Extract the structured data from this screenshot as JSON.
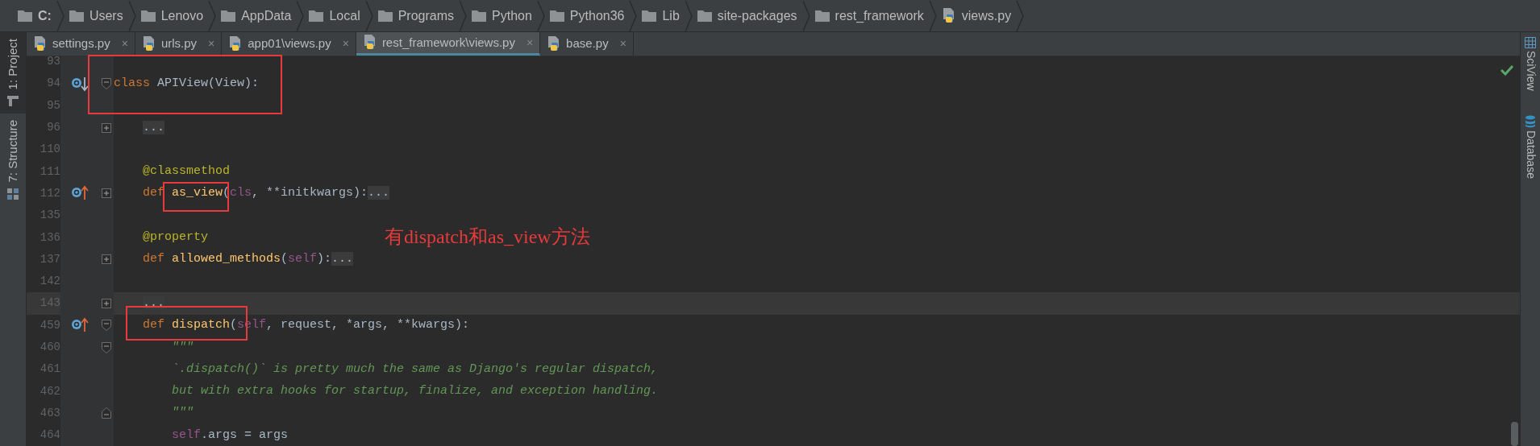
{
  "breadcrumb": [
    {
      "label": "C:",
      "kind": "drive"
    },
    {
      "label": "Users",
      "kind": "folder"
    },
    {
      "label": "Lenovo",
      "kind": "folder"
    },
    {
      "label": "AppData",
      "kind": "folder"
    },
    {
      "label": "Local",
      "kind": "folder"
    },
    {
      "label": "Programs",
      "kind": "folder"
    },
    {
      "label": "Python",
      "kind": "folder"
    },
    {
      "label": "Python36",
      "kind": "folder"
    },
    {
      "label": "Lib",
      "kind": "folder"
    },
    {
      "label": "site-packages",
      "kind": "folder"
    },
    {
      "label": "rest_framework",
      "kind": "folder"
    },
    {
      "label": "views.py",
      "kind": "file"
    }
  ],
  "tabs": [
    {
      "label": "settings.py",
      "close": "×",
      "selected": false
    },
    {
      "label": "urls.py",
      "close": "×",
      "selected": false
    },
    {
      "label": "app01\\views.py",
      "close": "×",
      "selected": false
    },
    {
      "label": "rest_framework\\views.py",
      "close": "×",
      "selected": true
    },
    {
      "label": "base.py",
      "close": "×",
      "selected": false
    }
  ],
  "left_tool_windows": [
    {
      "label": "1: Project",
      "selected": true
    },
    {
      "label": "7: Structure",
      "selected": false
    }
  ],
  "right_tool_windows": [
    {
      "label": "SciView",
      "kind": "sciview"
    },
    {
      "label": "Database",
      "kind": "database"
    }
  ],
  "code_lines": [
    {
      "number": "93",
      "current": false
    },
    {
      "number": "94",
      "current": false,
      "kind": "class",
      "marker": {
        "kind": "overridden"
      },
      "fold": {
        "kind": "start"
      },
      "tokens": [
        {
          "t": "class ",
          "kind": "keyword"
        },
        {
          "t": "APIView(View):",
          "kind": "plain"
        }
      ]
    },
    {
      "number": "95",
      "current": false
    },
    {
      "number": "96",
      "current": false,
      "kind": "method",
      "fold": {
        "kind": "plus"
      },
      "tokens": [
        {
          "t": "...",
          "kind": "folded"
        }
      ]
    },
    {
      "number": "110",
      "current": false
    },
    {
      "number": "111",
      "current": false,
      "kind": "method",
      "tokens": [
        {
          "t": "@classmethod",
          "kind": "decorator"
        }
      ]
    },
    {
      "number": "112",
      "current": false,
      "kind": "method",
      "marker": {
        "kind": "overrides"
      },
      "fold": {
        "kind": "plus"
      },
      "tokens": [
        {
          "t": "def ",
          "kind": "keyword"
        },
        {
          "t": "as_view",
          "kind": "function"
        },
        {
          "t": "(",
          "kind": "plain"
        },
        {
          "t": "cls",
          "kind": "self"
        },
        {
          "t": ", **initkwargs):",
          "kind": "plain"
        },
        {
          "t": "...",
          "kind": "folded"
        }
      ]
    },
    {
      "number": "135",
      "current": false
    },
    {
      "number": "136",
      "current": false,
      "kind": "method",
      "tokens": [
        {
          "t": "@property",
          "kind": "decorator"
        }
      ]
    },
    {
      "number": "137",
      "current": false,
      "kind": "method",
      "fold": {
        "kind": "plus"
      },
      "tokens": [
        {
          "t": "def ",
          "kind": "keyword"
        },
        {
          "t": "allowed_methods",
          "kind": "function"
        },
        {
          "t": "(",
          "kind": "plain"
        },
        {
          "t": "self",
          "kind": "self"
        },
        {
          "t": "):",
          "kind": "plain"
        },
        {
          "t": "...",
          "kind": "folded"
        }
      ]
    },
    {
      "number": "142",
      "current": false
    },
    {
      "number": "143",
      "current": true,
      "kind": "method",
      "fold": {
        "kind": "plus"
      },
      "tokens": [
        {
          "t": "...",
          "kind": "folded"
        }
      ]
    },
    {
      "number": "459",
      "current": false,
      "kind": "method",
      "marker": {
        "kind": "overrides"
      },
      "fold": {
        "kind": "start"
      },
      "tokens": [
        {
          "t": "def ",
          "kind": "keyword"
        },
        {
          "t": "dispatch",
          "kind": "function"
        },
        {
          "t": "(",
          "kind": "plain"
        },
        {
          "t": "self",
          "kind": "self"
        },
        {
          "t": ", request, *args, **kwargs):",
          "kind": "plain"
        }
      ]
    },
    {
      "number": "460",
      "current": false,
      "kind": "body",
      "fold": {
        "kind": "start"
      },
      "tokens": [
        {
          "t": "\"\"\"",
          "kind": "docstring"
        }
      ]
    },
    {
      "number": "461",
      "current": false,
      "kind": "body",
      "tokens": [
        {
          "t": "`.dispatch()` is pretty much the same as Django's regular dispatch,",
          "kind": "docstring"
        }
      ]
    },
    {
      "number": "462",
      "current": false,
      "kind": "body",
      "tokens": [
        {
          "t": "but with extra hooks for startup, finalize, and exception handling.",
          "kind": "docstring"
        }
      ]
    },
    {
      "number": "463",
      "current": false,
      "kind": "body",
      "fold": {
        "kind": "end"
      },
      "tokens": [
        {
          "t": "\"\"\"",
          "kind": "docstring"
        }
      ]
    },
    {
      "number": "464",
      "current": false,
      "kind": "body",
      "tokens": [
        {
          "t": "self",
          "kind": "self"
        },
        {
          "t": ".args = args",
          "kind": "plain"
        }
      ]
    }
  ],
  "annotation_note": "有dispatch和as_view方法"
}
